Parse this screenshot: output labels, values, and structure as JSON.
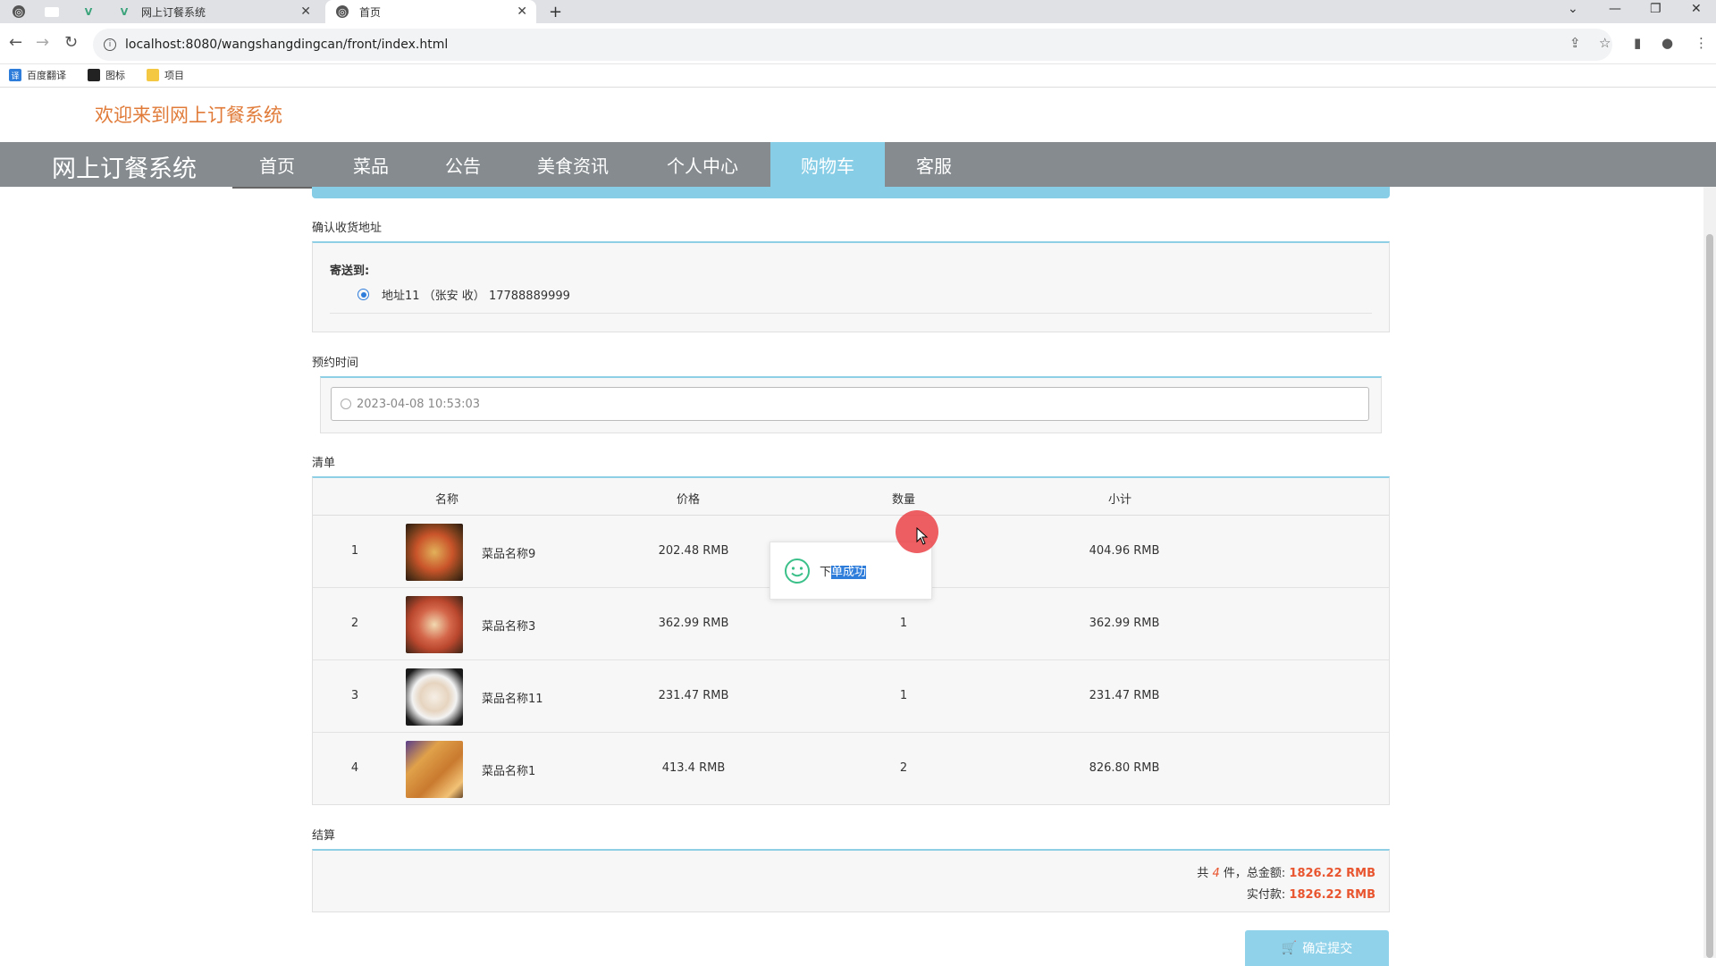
{
  "browser": {
    "tabs": [
      {
        "title": ""
      },
      {
        "title": ""
      },
      {
        "title": ""
      },
      {
        "title": "网上订餐系统"
      },
      {
        "title": "首页"
      }
    ],
    "new_tab_symbol": "+",
    "url": "localhost:8080/wangshangdingcan/front/index.html",
    "bookmarks": [
      "百度翻译",
      "图标",
      "项目"
    ]
  },
  "site": {
    "welcome": "欢迎来到网上订餐系统",
    "brand": "网上订餐系统",
    "menu": [
      "首页",
      "菜品",
      "公告",
      "美食资讯",
      "个人中心",
      "购物车",
      "客服"
    ],
    "active_menu": "购物车"
  },
  "address_section": {
    "title": "确认收货地址",
    "send_to_label": "寄送到:",
    "address": "地址11 （张安 收） 17788889999"
  },
  "time_section": {
    "title": "预约时间",
    "value": "2023-04-08 10:53:03"
  },
  "list_section": {
    "title": "清单",
    "headers": [
      "名称",
      "价格",
      "数量",
      "小计"
    ],
    "rows": [
      {
        "index": "1",
        "name": "菜品名称9",
        "price": "202.48 RMB",
        "qty": "",
        "subtotal": "404.96 RMB"
      },
      {
        "index": "2",
        "name": "菜品名称3",
        "price": "362.99 RMB",
        "qty": "1",
        "subtotal": "362.99 RMB"
      },
      {
        "index": "3",
        "name": "菜品名称11",
        "price": "231.47 RMB",
        "qty": "1",
        "subtotal": "231.47 RMB"
      },
      {
        "index": "4",
        "name": "菜品名称1",
        "price": "413.4 RMB",
        "qty": "2",
        "subtotal": "826.80 RMB"
      }
    ]
  },
  "settle_section": {
    "title": "结算",
    "count_prefix": "共",
    "count": "4",
    "count_suffix": "件，总金额:",
    "total": "1826.22 RMB",
    "paid_label": "实付款:",
    "paid": "1826.22 RMB"
  },
  "submit_label": "确定提交",
  "toast": {
    "msg_plain": "下",
    "msg_highlight": "单成功"
  },
  "colors": {
    "accent": "#87cde6",
    "nav_bg": "#858b8f",
    "welcome": "#e07b39",
    "price_red": "#e8552f"
  }
}
